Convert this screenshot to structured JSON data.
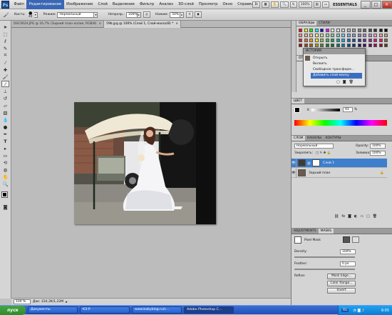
{
  "menubar": {
    "logo": "Ps",
    "items": [
      "Файл",
      "Редактирование",
      "Изображение",
      "Слой",
      "Выделение",
      "Фильтр",
      "Анализ",
      "3D-слой",
      "Просмотр",
      "Окно",
      "Справка"
    ],
    "active_index": 1,
    "zoom": "100%",
    "workspace": "ESSENTIALS"
  },
  "options": {
    "brush_label": "Кисть:",
    "brush_size": "40",
    "mode_label": "Режим:",
    "mode_value": "Нормальный",
    "opacity_label": "Непрозр.:",
    "opacity_value": "100%",
    "flow_label": "Нажим:",
    "flow_value": "50%"
  },
  "doc_tabs": [
    {
      "label": "DSC0624.JPG @ 16,7% (Задний план копия, RGB/8)",
      "active": false
    },
    {
      "label": "59b.jpg @ 100% (Слой 1, Слой-маска/8) *",
      "active": true
    }
  ],
  "status": {
    "zoom": "100 %",
    "doc_info": "Док: 334,3K/1,22M"
  },
  "swatches_panel": {
    "tabs": [
      "ОБРАЗЦЫ",
      "СТИЛИ"
    ]
  },
  "history": {
    "title": "ИСТОРИЯ",
    "items": [
      "Открыть",
      "Вклеить",
      "Свободное трансформ...",
      "Добавить слой-маску"
    ],
    "selected_index": 3
  },
  "color_panel": {
    "tab": "ЦВЕТ",
    "k_label": "K",
    "k_value": "93",
    "k_unit": "%"
  },
  "layers_panel": {
    "tabs": [
      "СЛОИ",
      "КАНАЛЫ",
      "КОНТУРЫ"
    ],
    "blend_mode": "Нормальный",
    "opacity_label": "Opacity:",
    "opacity_value": "100%",
    "lock_label": "Закрепить:",
    "fill_label": "Заливка:",
    "fill_value": "100%",
    "layers": [
      {
        "name": "Слой 1",
        "selected": true
      },
      {
        "name": "Задний план",
        "selected": false
      }
    ]
  },
  "masks_panel": {
    "tabs": [
      "ADJUSTMENTS",
      "MASKS"
    ],
    "active_tab": 1,
    "title": "Pixel Mask",
    "density_label": "Density:",
    "density_value": "100%",
    "feather_label": "Feather:",
    "feather_value": "0 px",
    "refine_label": "Refine:",
    "mask_edge": "Mask Edge...",
    "color_range": "Color Range...",
    "invert": "Invert"
  },
  "taskbar": {
    "start": "пуск",
    "tasks": [
      {
        "label": "Документы",
        "active": false
      },
      {
        "label": "КЭ Р",
        "active": false
      },
      {
        "label": "www.babyblog.ru/c...",
        "active": false
      },
      {
        "label": "Adobe Photoshop C...",
        "active": true
      }
    ],
    "lang": "RU",
    "clock": "9:05"
  },
  "colors": {
    "accent": "#3a6fc0",
    "layer_selected": "#3d7fcc"
  }
}
